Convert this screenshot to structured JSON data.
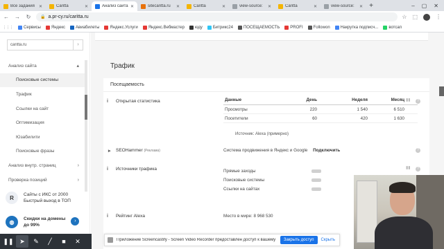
{
  "browser": {
    "tabs": [
      {
        "label": "Все задания",
        "color": "#f4b400",
        "active": false
      },
      {
        "label": "Caritta",
        "color": "#f4b400",
        "active": false
      },
      {
        "label": "Анализ сайта",
        "color": "#1a73e8",
        "active": true
      },
      {
        "label": "sitecaritta.ru",
        "color": "#e8710a",
        "active": false
      },
      {
        "label": "Caritta",
        "color": "#f4b400",
        "active": false
      },
      {
        "label": "view-source:",
        "color": "#9aa0a6",
        "active": false
      },
      {
        "label": "Caritta",
        "color": "#f4b400",
        "active": false
      },
      {
        "label": "view-source:",
        "color": "#9aa0a6",
        "active": false
      }
    ],
    "url": "a.pr-cy.ru/caritta.ru",
    "bookmarks": [
      {
        "label": "Сервисы",
        "color": "#4285f4"
      },
      {
        "label": "Яндекс",
        "color": "#e53935"
      },
      {
        "label": "Авиабилеты",
        "color": "#1565c0"
      },
      {
        "label": "Яндекс.Услуги",
        "color": "#e53935"
      },
      {
        "label": "Яндекс.Вебмастер",
        "color": "#e53935"
      },
      {
        "label": "юду",
        "color": "#333333"
      },
      {
        "label": "Битрикс24",
        "color": "#2fc6f6"
      },
      {
        "label": "ПОСЕЩАЕМОСТЬ",
        "color": "#555555"
      },
      {
        "label": "PROFI",
        "color": "#e53935"
      },
      {
        "label": "Followon",
        "color": "#555555"
      },
      {
        "label": "Накрутка подписч...",
        "color": "#4285f4"
      },
      {
        "label": "вотсап",
        "color": "#25d366"
      }
    ]
  },
  "sidebar": {
    "search_value": "caritta.ru",
    "items": [
      {
        "label": "Анализ сайта",
        "sub": false,
        "active": false,
        "arrow": "▴"
      },
      {
        "label": "Поисковые системы",
        "sub": true,
        "active": true,
        "arrow": ""
      },
      {
        "label": "Трафик",
        "sub": true,
        "active": false,
        "arrow": ""
      },
      {
        "label": "Ссылки на сайт",
        "sub": true,
        "active": false,
        "arrow": ""
      },
      {
        "label": "Оптимизация",
        "sub": true,
        "active": false,
        "arrow": ""
      },
      {
        "label": "Юзабилити",
        "sub": true,
        "active": false,
        "arrow": ""
      },
      {
        "label": "Поисковые фразы",
        "sub": true,
        "active": false,
        "arrow": ""
      },
      {
        "label": "Анализ внутр. страниц",
        "sub": false,
        "active": false,
        "arrow": "›"
      },
      {
        "label": "Проверка позиций",
        "sub": false,
        "active": false,
        "arrow": "›"
      }
    ],
    "promo1": {
      "line1": "Сайты с ИКС от 2000",
      "line2": "Быстрый выход в ТОП"
    },
    "promo2": {
      "line1": "Скидки на домены",
      "line2": "до 99%"
    }
  },
  "main": {
    "section_title": "Трафик",
    "card_title": "Посещаемость",
    "open_stats": {
      "label": "Открытая статистика",
      "headers": {
        "name": "Данные",
        "day": "День",
        "week": "Неделя",
        "month": "Месяц"
      },
      "rows": [
        {
          "name": "Просмотры",
          "day": "220",
          "week": "1 540",
          "month": "6 510"
        },
        {
          "name": "Посетители",
          "day": "60",
          "week": "420",
          "month": "1 630"
        }
      ],
      "source": "Источник: Alexa (примерно)"
    },
    "seohammer": {
      "label": "SEOHammer",
      "tag": "(Реклама)",
      "text": "Система продвижения в Яндекс и Google",
      "link": "Подключить"
    },
    "traffic_sources": {
      "label": "Источники трафика",
      "items": [
        "Прямые заходы",
        "Поисковые системы",
        "Ссылки на сайтах"
      ]
    },
    "alexa": {
      "label": "Рейтинг Alexa",
      "text": "Место в мире: 8 968 530"
    }
  },
  "notification": {
    "text": "Приложение Screencastify - Screen Video Recorder предоставлен доступ к вашему экрану.",
    "allow": "Закрыть доступ",
    "hide": "Скрыть"
  }
}
